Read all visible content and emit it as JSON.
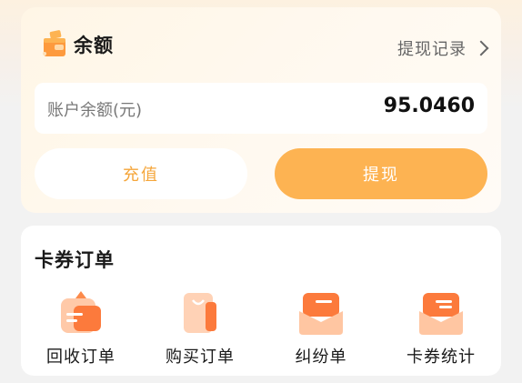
{
  "balance": {
    "title": "余额",
    "icon": "wallet-icon",
    "records_link": "提现记录",
    "account_label": "账户余额(元)",
    "account_value": "95.0460",
    "recharge_label": "充值",
    "withdraw_label": "提现"
  },
  "orders": {
    "title": "卡券订单",
    "items": [
      {
        "label": "回收订单",
        "icon": "recycle-order-icon"
      },
      {
        "label": "购买订单",
        "icon": "purchase-order-icon"
      },
      {
        "label": "纠纷单",
        "icon": "dispute-order-icon"
      },
      {
        "label": "卡券统计",
        "icon": "coupon-stats-icon"
      }
    ]
  },
  "colors": {
    "accent": "#fdb352",
    "accent_text": "#f5a63b",
    "icon_orange": "#fc7a3c"
  }
}
